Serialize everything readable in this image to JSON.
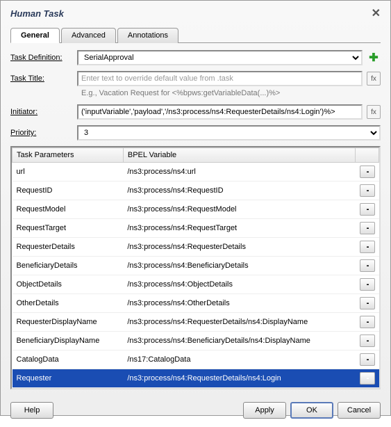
{
  "title": "Human Task",
  "tabs": {
    "general": "General",
    "advanced": "Advanced",
    "annotations": "Annotations"
  },
  "form": {
    "taskDefinitionLabel": "Task Definition:",
    "taskDefinitionValue": "SerialApproval",
    "taskTitleLabel": "Task Title:",
    "taskTitlePlaceholder": "Enter text to override default value from .task",
    "taskTitleHint": "E.g., Vacation Request for <%bpws:getVariableData(...)%>",
    "initiatorLabel": "Initiator:",
    "initiatorValue": "('inputVariable','payload','/ns3:process/ns4:RequesterDetails/ns4:Login')%>",
    "priorityLabel": "Priority:",
    "priorityValue": "3"
  },
  "table": {
    "headers": {
      "param": "Task Parameters",
      "var": "BPEL Variable"
    },
    "rows": [
      {
        "param": "url",
        "var": "/ns3:process/ns4:url",
        "selected": false
      },
      {
        "param": "RequestID",
        "var": "/ns3:process/ns4:RequestID",
        "selected": false
      },
      {
        "param": "RequestModel",
        "var": "/ns3:process/ns4:RequestModel",
        "selected": false
      },
      {
        "param": "RequestTarget",
        "var": "/ns3:process/ns4:RequestTarget",
        "selected": false
      },
      {
        "param": "RequesterDetails",
        "var": "/ns3:process/ns4:RequesterDetails",
        "selected": false
      },
      {
        "param": "BeneficiaryDetails",
        "var": "/ns3:process/ns4:BeneficiaryDetails",
        "selected": false
      },
      {
        "param": "ObjectDetails",
        "var": "/ns3:process/ns4:ObjectDetails",
        "selected": false
      },
      {
        "param": "OtherDetails",
        "var": "/ns3:process/ns4:OtherDetails",
        "selected": false
      },
      {
        "param": "RequesterDisplayName",
        "var": "/ns3:process/ns4:RequesterDetails/ns4:DisplayName",
        "selected": false
      },
      {
        "param": "BeneficiaryDisplayName",
        "var": "/ns3:process/ns4:BeneficiaryDetails/ns4:DisplayName",
        "selected": false
      },
      {
        "param": "CatalogData",
        "var": "/ns17:CatalogData",
        "selected": false
      },
      {
        "param": "Requester",
        "var": "/ns3:process/ns4:RequesterDetails/ns4:Login",
        "selected": true
      }
    ]
  },
  "buttons": {
    "help": "Help",
    "apply": "Apply",
    "ok": "OK",
    "cancel": "Cancel"
  },
  "rowBtn": "..."
}
